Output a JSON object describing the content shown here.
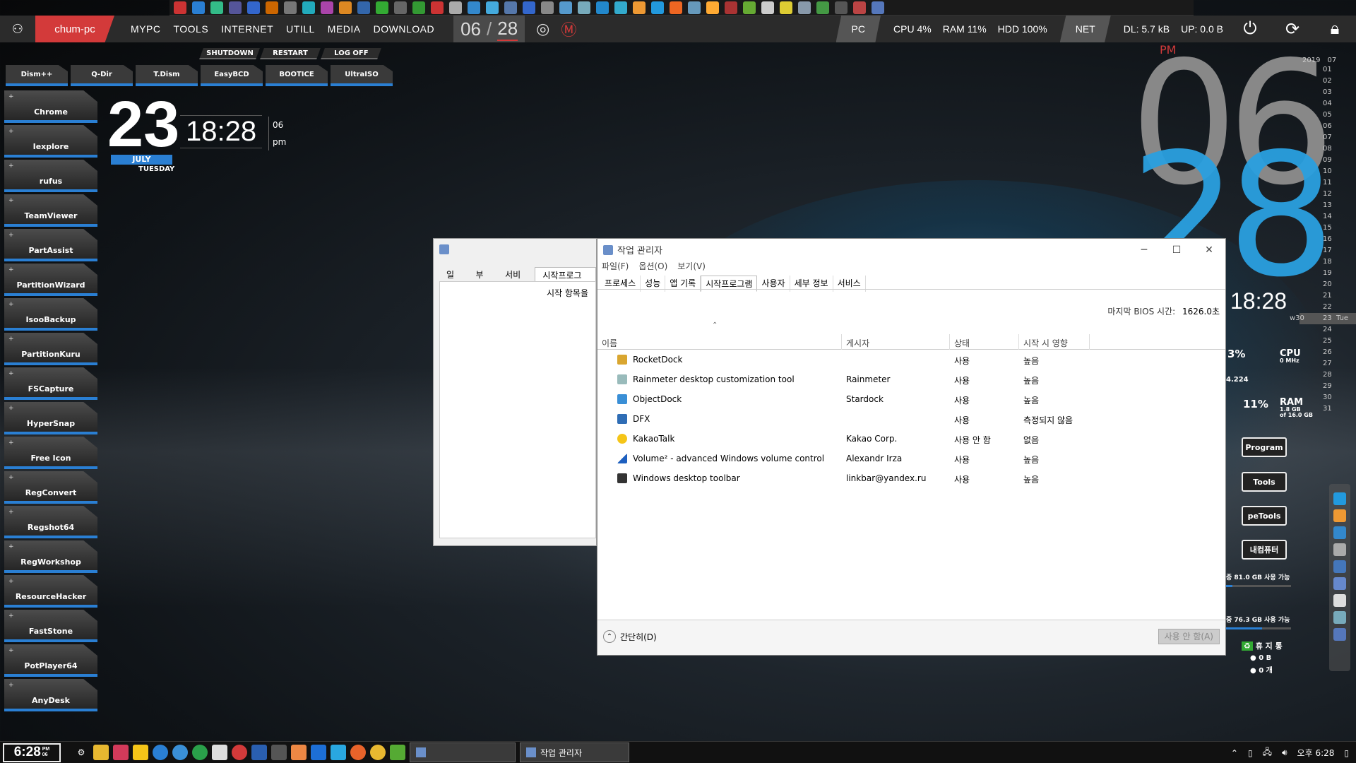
{
  "topbar": {
    "pc_name": "chum-pc",
    "menus": [
      "MYPC",
      "TOOLS",
      "INTERNET",
      "UTILL",
      "MEDIA",
      "DOWNLOAD"
    ],
    "month": "06",
    "day": "28",
    "pc_tag": "PC",
    "cpu": "CPU  4%",
    "ram": "RAM  11%",
    "hdd": "HDD  100%",
    "net_tag": "NET",
    "dl": "DL:  5.7 kB",
    "up": "UP:  0.0 B"
  },
  "power_buttons": [
    "SHUTDOWN",
    "RESTART",
    "LOG OFF"
  ],
  "tool_buttons": [
    "Dism++",
    "Q-Dir",
    "T.Dism",
    "EasyBCD",
    "BOOTICE",
    "UltraISO"
  ],
  "launcher": [
    "Chrome",
    "Iexplore",
    "rufus",
    "TeamViewer",
    "PartAssist",
    "PartitionWizard",
    "IsooBackup",
    "PartitionKuru",
    "FSCapture",
    "HyperSnap",
    "Free Icon",
    "RegConvert",
    "Regshot64",
    "RegWorkshop",
    "ResourceHacker",
    "FastStone",
    "PotPlayer64",
    "AnyDesk"
  ],
  "date_widget": {
    "day": "23",
    "month": "JULY",
    "weekday": "TUESDAY",
    "time": "18:28",
    "small_top": "06",
    "small_bottom": "pm"
  },
  "big_clock": {
    "pm": "PM",
    "hour": "06",
    "minute": "28",
    "time": "18:28"
  },
  "calendar": {
    "year": "2019",
    "month": "07",
    "days": [
      "01",
      "02",
      "03",
      "04",
      "05",
      "06",
      "07",
      "08",
      "09",
      "10",
      "11",
      "12",
      "13",
      "14",
      "15",
      "16",
      "17",
      "18",
      "19",
      "20",
      "21",
      "22",
      "23",
      "24",
      "25",
      "26",
      "27",
      "28",
      "29",
      "30",
      "31"
    ],
    "week_label": "w30",
    "today_weekday": "Tue"
  },
  "system_widget": {
    "cpu_pct": "3%",
    "cpu_label": "CPU",
    "cpu_sub": "0 MHz",
    "cpu_value": "4.224",
    "ram_pct": "11%",
    "ram_label": "RAM",
    "ram_sub1": "1.8 GB",
    "ram_sub2": "of 16.0 GB",
    "buttons": [
      "Program",
      "Tools",
      "peTools",
      "내컴퓨터"
    ],
    "disk1": "중 81.0 GB 사용 가능",
    "disk2": "중 76.3 GB 사용 가능",
    "trash_label": "휴 지 통",
    "trash_size": "0 B",
    "trash_count": "0 개"
  },
  "msconfig": {
    "tabs": [
      "일반",
      "부팅",
      "서비스",
      "시작프로그램"
    ],
    "content_text": "시작 항목을"
  },
  "task_manager": {
    "title": "작업 관리자",
    "menu": [
      "파일(F)",
      "옵션(O)",
      "보기(V)"
    ],
    "tabs": [
      "프로세스",
      "성능",
      "앱 기록",
      "시작프로그램",
      "사용자",
      "세부 정보",
      "서비스"
    ],
    "bios_label": "마지막 BIOS 시간:",
    "bios_value": "1626.0초",
    "columns": [
      "이름",
      "게시자",
      "상태",
      "시작 시 영향"
    ],
    "rows": [
      {
        "name": "RocketDock",
        "publisher": "",
        "status": "사용",
        "impact": "높음"
      },
      {
        "name": "Rainmeter desktop customization tool",
        "publisher": "Rainmeter",
        "status": "사용",
        "impact": "높음"
      },
      {
        "name": "ObjectDock",
        "publisher": "Stardock",
        "status": "사용",
        "impact": "높음"
      },
      {
        "name": "DFX",
        "publisher": "",
        "status": "사용",
        "impact": "측정되지 않음"
      },
      {
        "name": "KakaoTalk",
        "publisher": "Kakao Corp.",
        "status": "사용 안 함",
        "impact": "없음"
      },
      {
        "name": "Volume² - advanced Windows volume control",
        "publisher": "Alexandr Irza",
        "status": "사용",
        "impact": "높음"
      },
      {
        "name": "Windows desktop toolbar",
        "publisher": "linkbar@yandex.ru",
        "status": "사용",
        "impact": "높음"
      }
    ],
    "fewer_details": "간단히(D)",
    "disable_button": "사용 안 함(A)"
  },
  "taskbar": {
    "clock": "6:28",
    "clock_pm": "PM",
    "clock_day": "06",
    "task_label": "작업 관리자",
    "tray_time": "오후 6:28"
  },
  "colors": {
    "accent_blue": "#2a7fd3",
    "accent_red": "#d33a3a",
    "clock_blue": "#2aa0e0"
  }
}
